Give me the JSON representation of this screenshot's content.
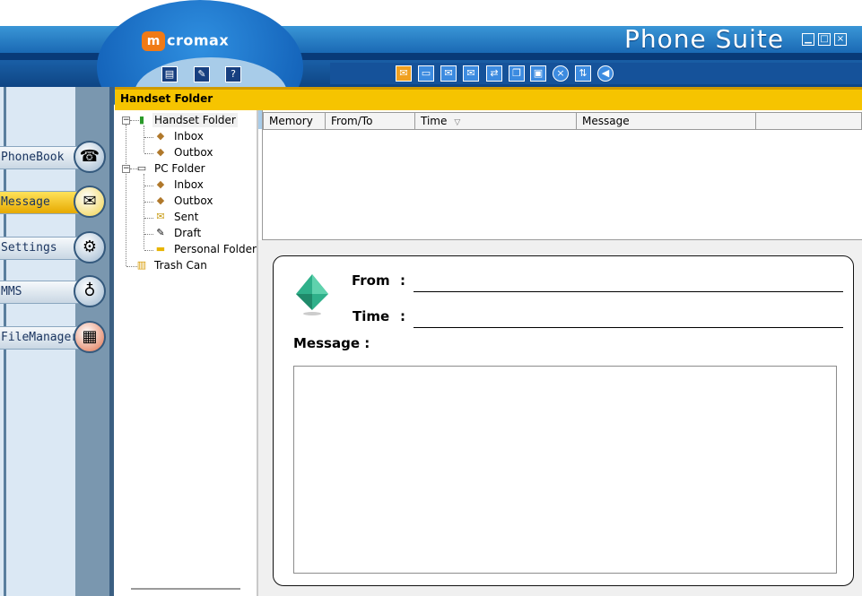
{
  "app": {
    "brand": "micromax",
    "brand_mark": "m",
    "brand_text": "cromax",
    "title": "Phone Suite"
  },
  "window_controls": [
    "minimize-icon",
    "maximize-icon",
    "close-icon"
  ],
  "toolbar_left": [
    "clipboard-icon",
    "edit-icon",
    "help-icon"
  ],
  "toolbar_right": [
    "new-message-icon",
    "open-icon",
    "send-icon",
    "receive-icon",
    "transfer-icon",
    "copy-icon",
    "paste-icon",
    "delete-icon",
    "sort-icon",
    "refresh-icon"
  ],
  "nav": {
    "items": [
      {
        "label": "PhoneBook",
        "icon": "phone-icon",
        "active": false
      },
      {
        "label": "Message",
        "icon": "envelope-icon",
        "active": true
      },
      {
        "label": "Settings",
        "icon": "settings-icon",
        "active": false
      },
      {
        "label": "MMS",
        "icon": "balloon-icon",
        "active": false
      },
      {
        "label": "FileManager",
        "icon": "file-cabinet-icon",
        "active": false
      }
    ]
  },
  "folder_header": "Handset Folder",
  "tree": {
    "handset": {
      "label": "Handset Folder",
      "expander": "−",
      "children": [
        "Inbox",
        "Outbox"
      ]
    },
    "pc": {
      "label": "PC Folder",
      "expander": "−",
      "children": [
        "Inbox",
        "Outbox",
        "Sent",
        "Draft",
        "Personal Folder"
      ]
    },
    "trash": {
      "label": "Trash Can"
    }
  },
  "list": {
    "columns": [
      "Memory",
      "From/To",
      "Time",
      "Message"
    ],
    "sort_column": "Time",
    "sort_indicator": "▽",
    "rows": []
  },
  "message_view": {
    "from_label": "From",
    "time_label": "Time",
    "colon": ":",
    "message_label": "Message :",
    "from_value": "",
    "time_value": "",
    "body": ""
  },
  "colors": {
    "header_yellow": "#f6c400",
    "title_blue": "#1a69b4",
    "nav_active": "#f2c100"
  }
}
